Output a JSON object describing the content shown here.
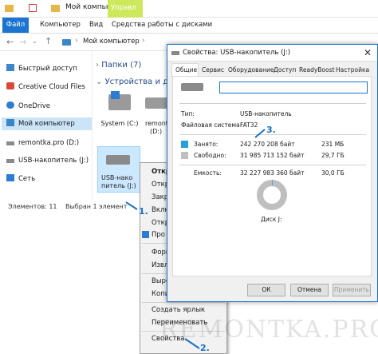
{
  "explorer": {
    "title": "Мой компьют",
    "context_tab": "Управл",
    "ribbon_tabs": [
      "Файл",
      "Компьютер",
      "Вид",
      "Средства работы с дисками"
    ],
    "address": "Мой компьютер",
    "nav": [
      "Быстрый доступ",
      "Creative Cloud Files",
      "OneDrive",
      "Мой компьютер",
      "remontka.pro (D:)",
      "USB-накопитель (J:)",
      "Сеть"
    ],
    "section_folders": "Папки (7)",
    "section_devices": "Устройства и ди",
    "drives": {
      "c_label": "System (C:)",
      "d_label": "remontka",
      "d_label2": "(D:)",
      "usb_label": "USB-нако",
      "usb_label2": "питель (J:)"
    },
    "status_items": "Элементов: 11",
    "status_selected": "Выбран 1 элемент"
  },
  "context_menu": {
    "items_top": [
      "Откр",
      "Откр",
      "Закр",
      "Вклю",
      "Откр",
      "Про"
    ],
    "items_mid": [
      "Форм",
      "Извл"
    ],
    "items_mid2": [
      "Выре",
      "Копи"
    ],
    "create_shortcut": "Создать ярлык",
    "rename": "Переименовать",
    "properties": "Свойства"
  },
  "dialog": {
    "title": "Свойства: USB-накопитель (J:)",
    "tabs": [
      "Общие",
      "Сервис",
      "Оборудование",
      "Доступ",
      "ReadyBoost",
      "Настройка"
    ],
    "type_label": "Тип:",
    "type_value": "USB-накопитель",
    "fs_label": "Файловая система:",
    "fs_value": "FAT32",
    "used_label": "Занято:",
    "used_bytes": "242 270 208 байт",
    "used_size": "231 МБ",
    "free_label": "Свободно:",
    "free_bytes": "31 985 713 152 байт",
    "free_size": "29,7 ГБ",
    "cap_label": "Емкость:",
    "cap_bytes": "32 227 983 360 байт",
    "cap_size": "30,0 ГБ",
    "disk_label": "Диск J:",
    "used_fraction": 0.0075,
    "buttons": [
      "ОК",
      "Отмена",
      "Применить"
    ],
    "colors": {
      "used": "#26a0da",
      "free": "#bfbfbf"
    }
  },
  "annotations": [
    "1.",
    "2.",
    "3."
  ],
  "watermark": "REMONTKA.PRO"
}
